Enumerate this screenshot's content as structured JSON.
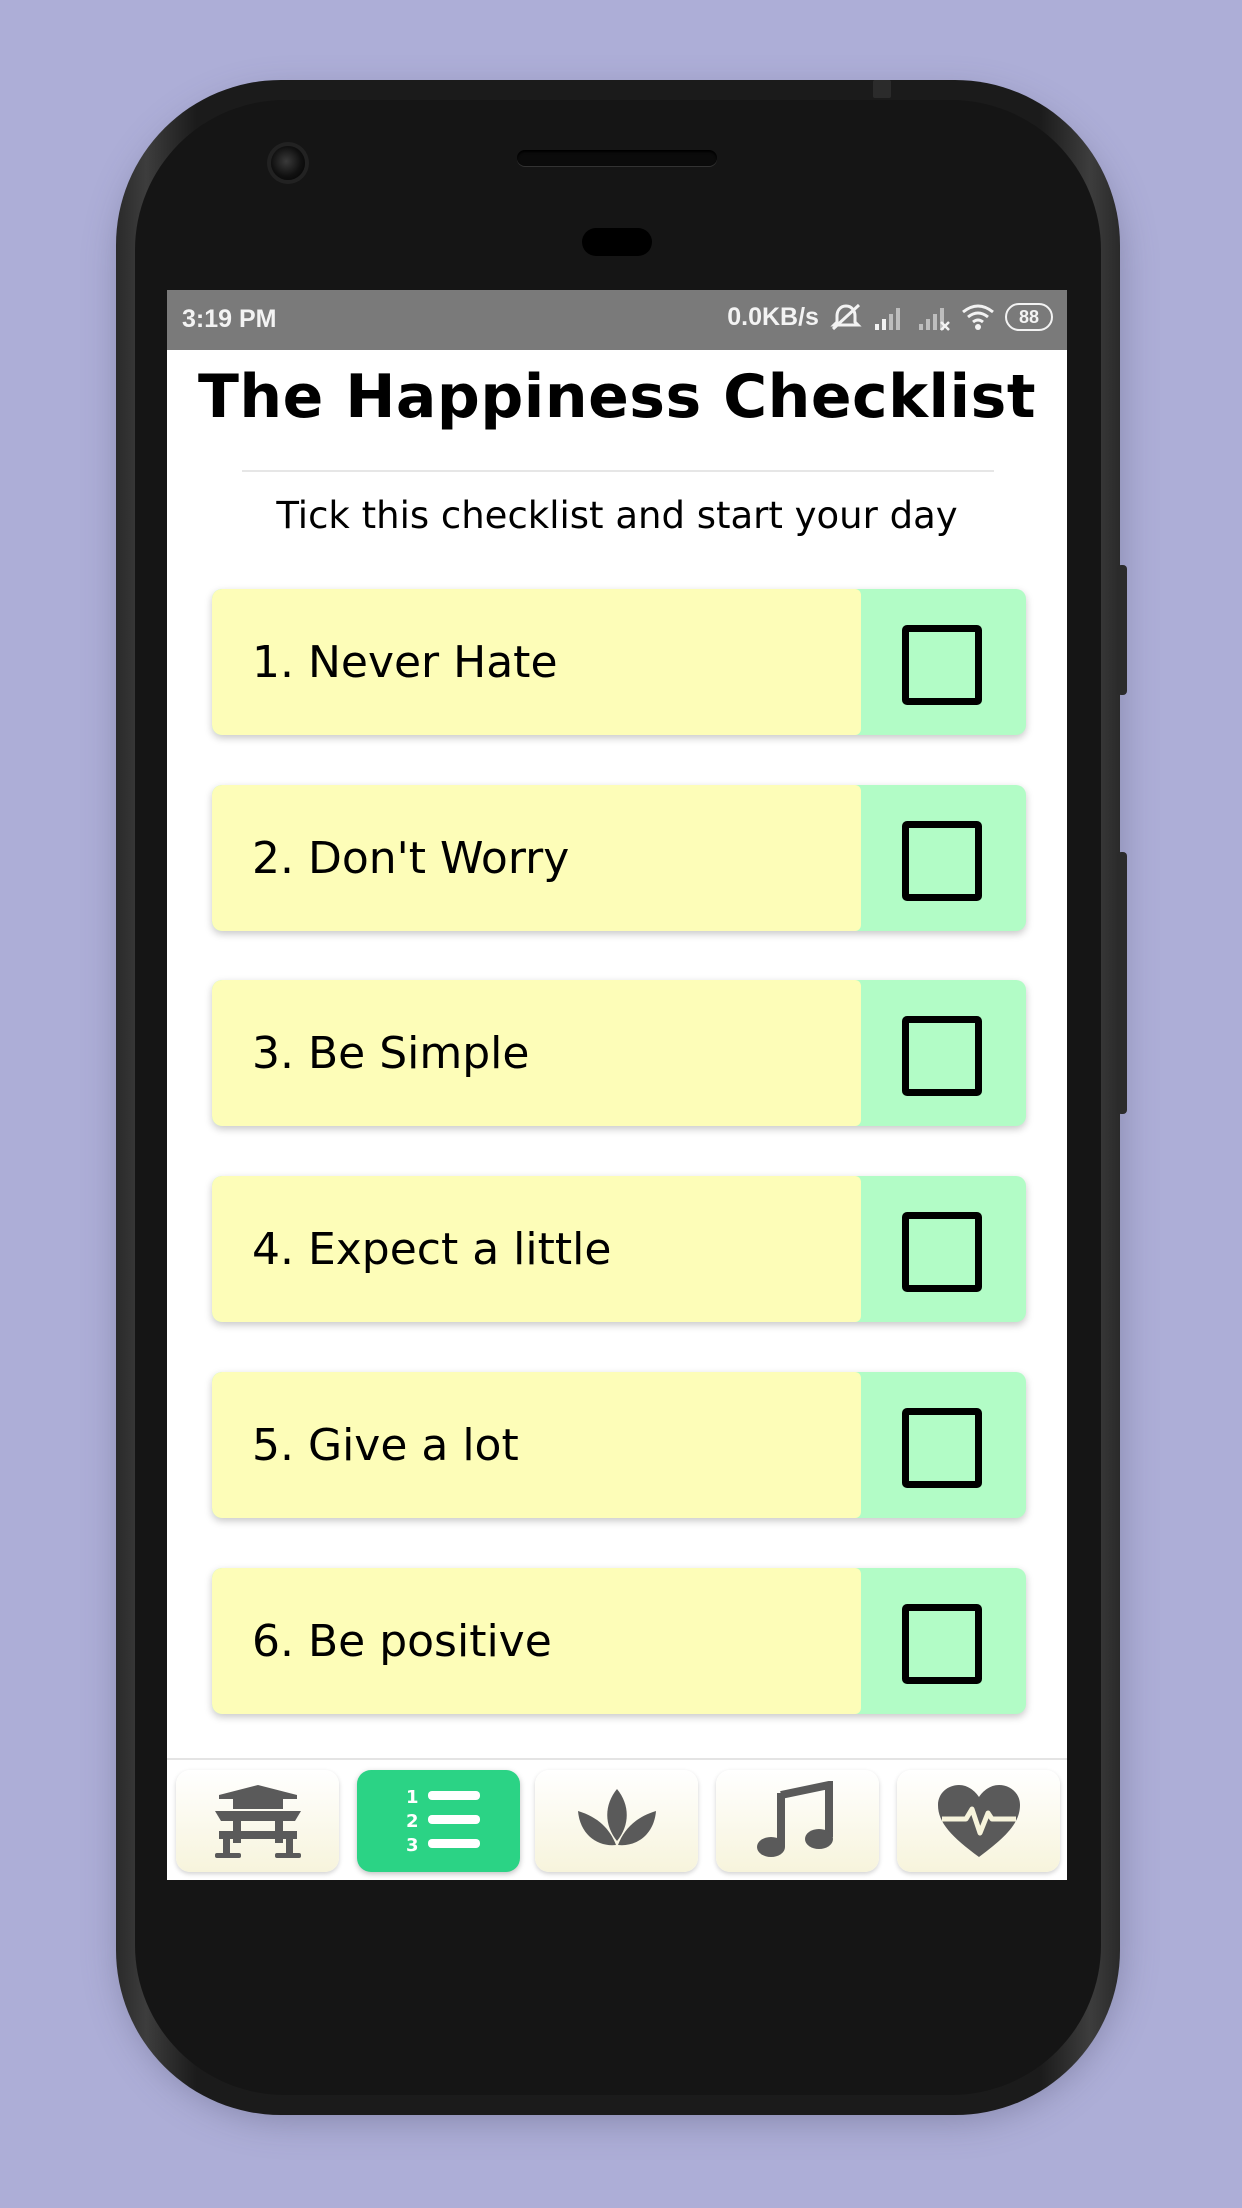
{
  "status_bar": {
    "time": "3:19 PM",
    "network_speed": "0.0KB/s",
    "battery": "88",
    "icons": [
      "alarm-off-icon",
      "signal-icon",
      "signal-x-icon",
      "wifi-icon",
      "battery-icon"
    ]
  },
  "header": {
    "title": "The Happiness Checklist",
    "subtitle": "Tick this checklist and start your day"
  },
  "checklist": {
    "items": [
      {
        "label": "1. Never Hate",
        "checked": false
      },
      {
        "label": "2. Don't Worry",
        "checked": false
      },
      {
        "label": "3. Be Simple",
        "checked": false
      },
      {
        "label": "4. Expect a little",
        "checked": false
      },
      {
        "label": "5. Give a lot",
        "checked": false
      },
      {
        "label": "6. Be positive",
        "checked": false
      }
    ]
  },
  "bottom_nav": {
    "items": [
      {
        "icon": "temple-icon",
        "active": false
      },
      {
        "icon": "numbered-list-icon",
        "active": true
      },
      {
        "icon": "lotus-icon",
        "active": false
      },
      {
        "icon": "music-note-icon",
        "active": false
      },
      {
        "icon": "heartbeat-icon",
        "active": false
      }
    ]
  },
  "colors": {
    "background": "#adaed7",
    "item_label_bg": "#fdfdb8",
    "item_check_bg": "#b2fcc6",
    "nav_active": "#2bd385",
    "nav_icon": "#5a5a5a"
  }
}
